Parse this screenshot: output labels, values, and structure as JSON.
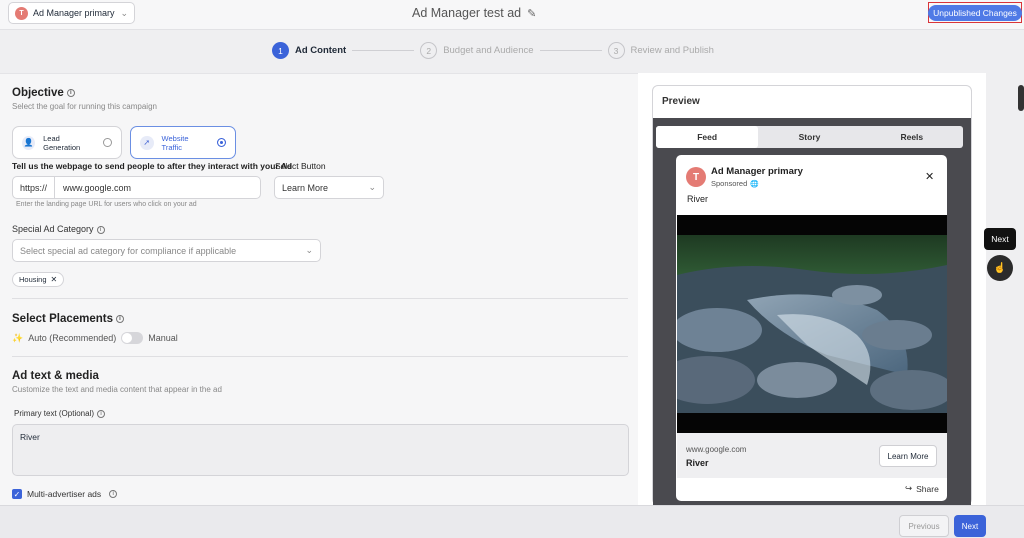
{
  "header": {
    "account_name": "Ad Manager primary",
    "account_initial": "T",
    "title": "Ad Manager test ad",
    "unpublished": "Unpublished Changes"
  },
  "steps": [
    {
      "num": "1",
      "label": "Ad Content"
    },
    {
      "num": "2",
      "label": "Budget and Audience"
    },
    {
      "num": "3",
      "label": "Review and Publish"
    }
  ],
  "objective": {
    "title": "Objective",
    "subtitle": "Select the goal for running this campaign",
    "options": [
      "Lead Generation",
      "Website Traffic"
    ],
    "selected": "Website Traffic"
  },
  "webpage": {
    "label": "Tell us the webpage to send people to after they interact with your Ad",
    "prefix": "https://",
    "value": "www.google.com",
    "hint": "Enter the landing page URL for users who click on your ad"
  },
  "select_button": {
    "label": "Select Button",
    "value": "Learn More"
  },
  "special_category": {
    "label": "Special Ad Category",
    "placeholder": "Select special ad category for compliance if applicable",
    "tags": [
      "Housing"
    ]
  },
  "placements": {
    "title": "Select Placements",
    "auto": "Auto (Recommended)",
    "manual": "Manual"
  },
  "ad_text": {
    "title": "Ad text & media",
    "subtitle": "Customize the text and media content that appear in the ad",
    "primary_label": "Primary text (Optional)",
    "primary_value": "River",
    "multi_advertiser": "Multi-advertiser ads"
  },
  "preview": {
    "title": "Preview",
    "tabs": [
      "Feed",
      "Story",
      "Reels"
    ],
    "active_tab": "Feed",
    "page_name": "Ad Manager primary",
    "sponsored": "Sponsored",
    "caption": "River",
    "url": "www.google.com",
    "headline": "River",
    "cta": "Learn More",
    "share": "Share"
  },
  "footer": {
    "previous": "Previous",
    "next": "Next"
  },
  "tooltip": {
    "text": "Next"
  },
  "colors": {
    "accent": "#3b63d9",
    "unpublished_bg": "#4f7ae6",
    "highlight_border": "#d9343a"
  }
}
